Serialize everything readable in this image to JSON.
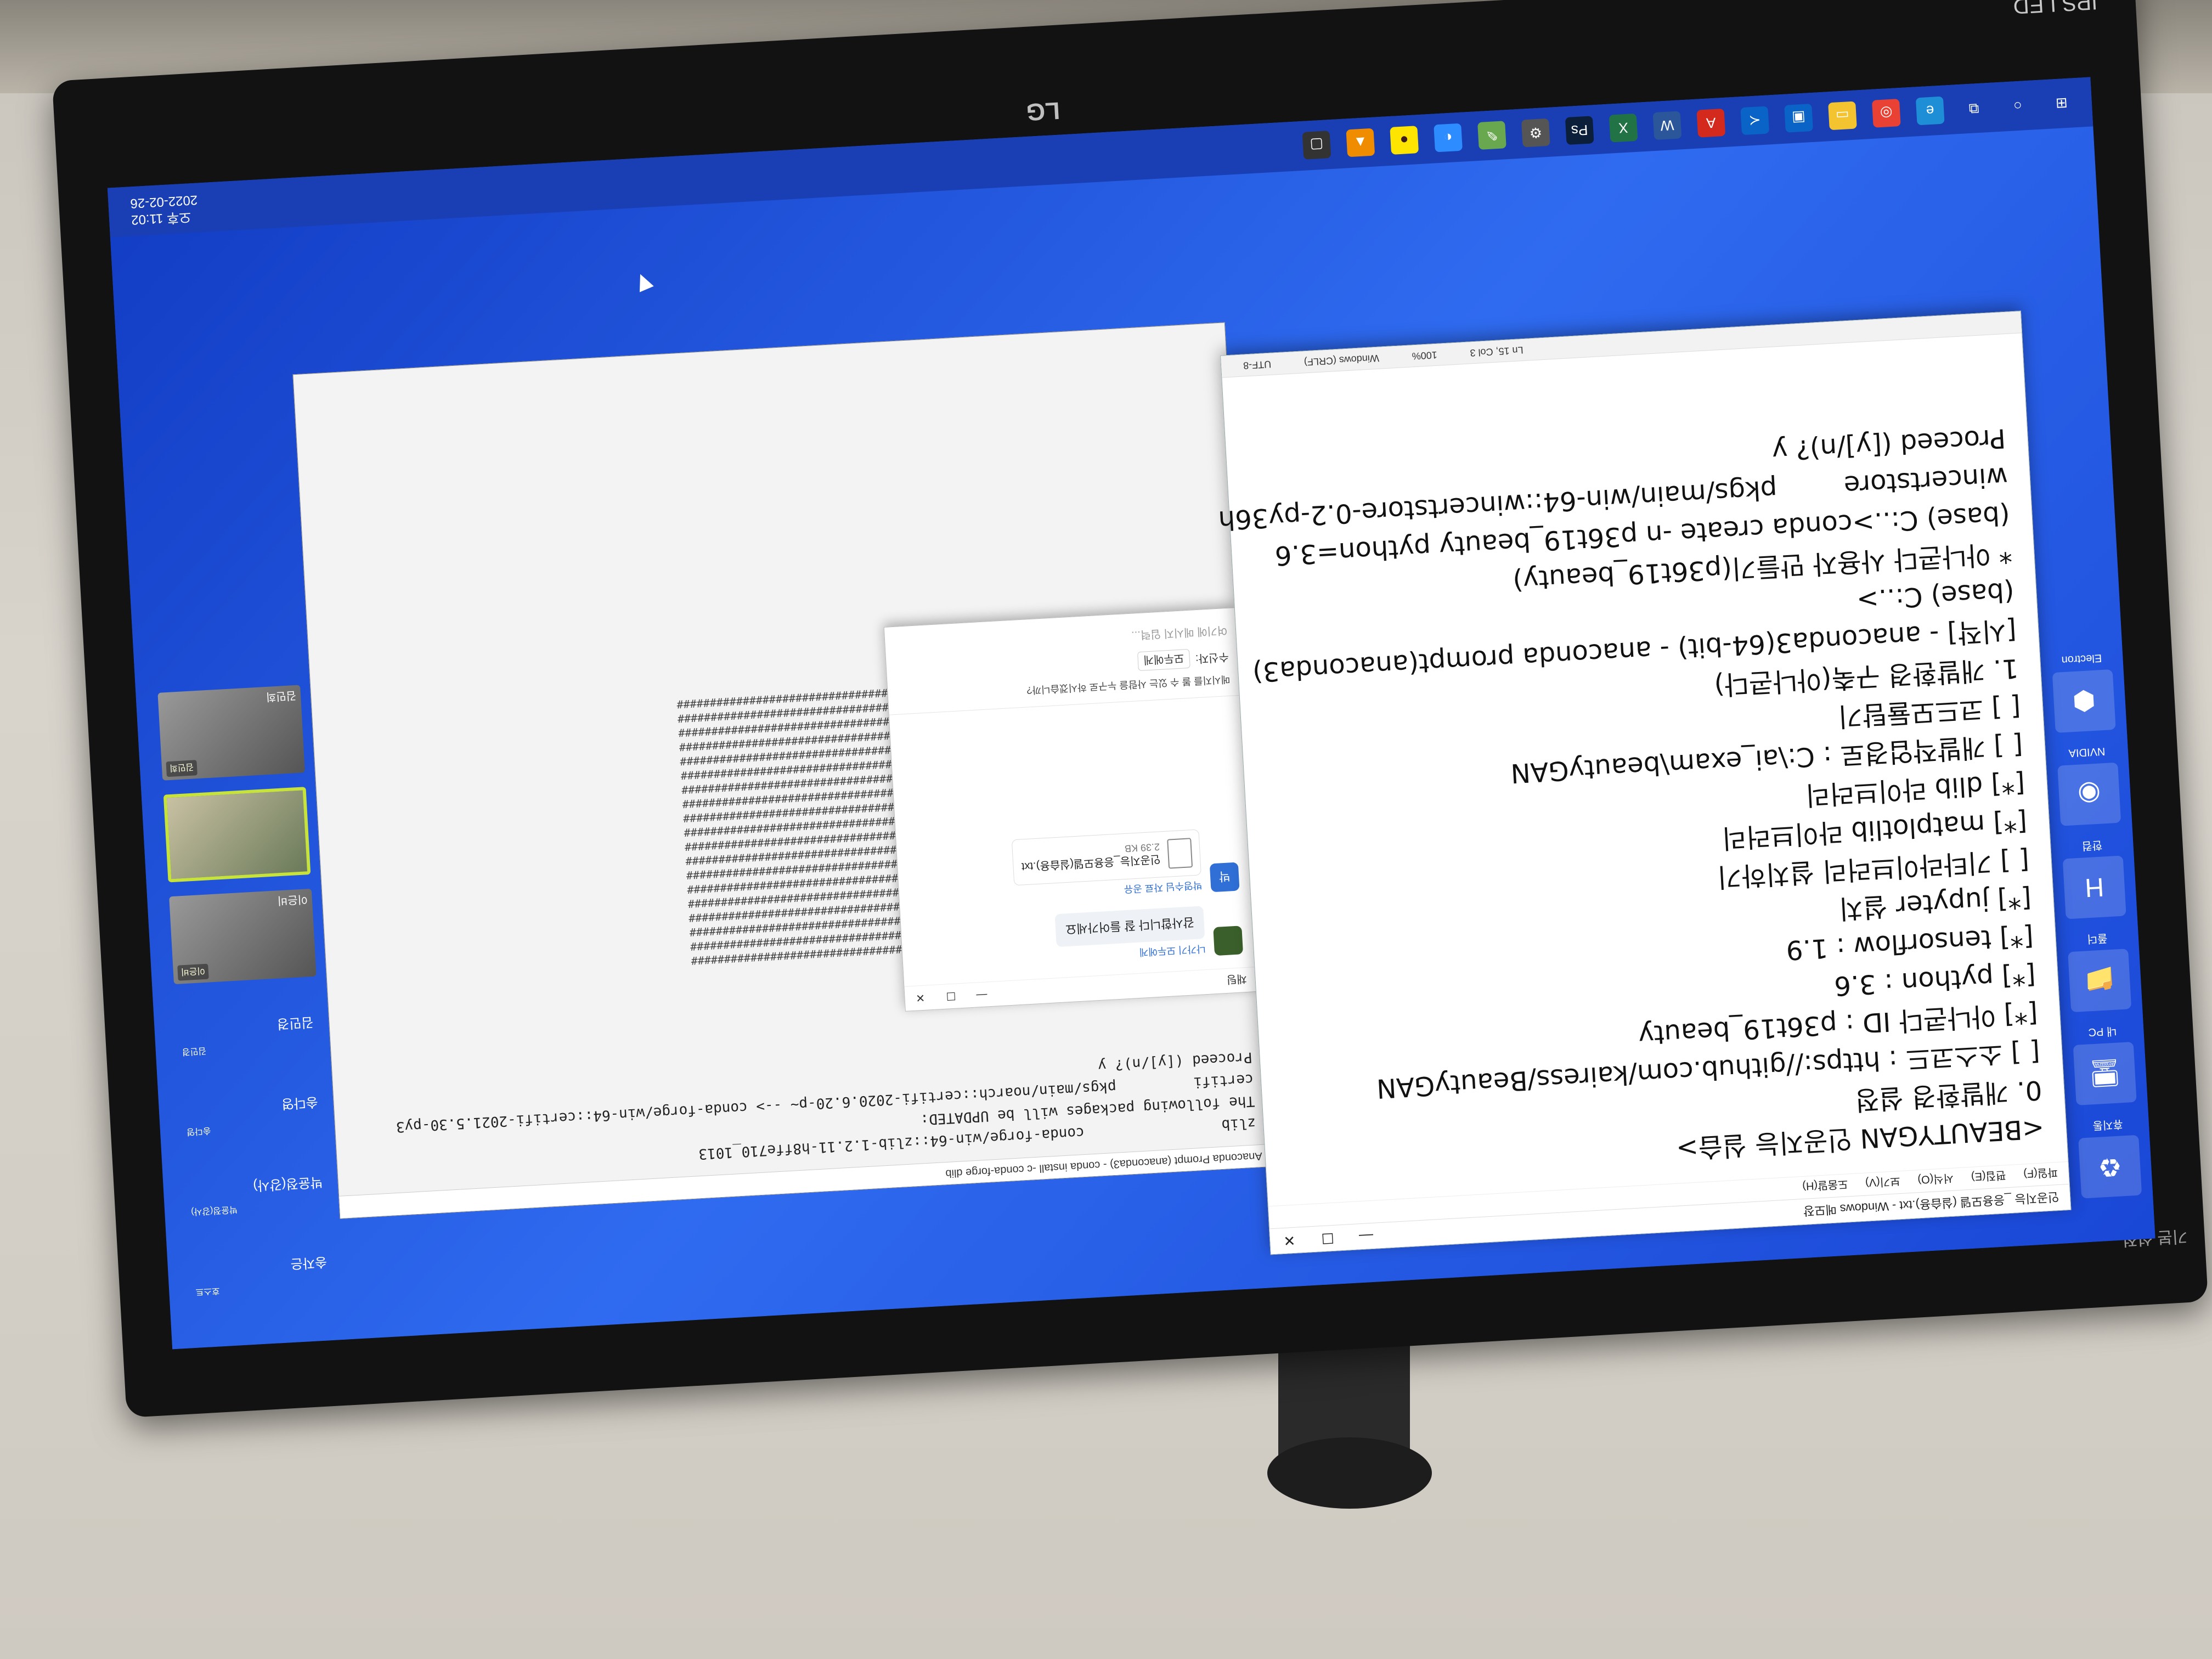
{
  "monitor": {
    "brand": "LG",
    "panel_label": "IPS LED",
    "bezel_text": "기본 설정"
  },
  "notepad": {
    "title": "인공지능 _응용모델 (실습용).txt - Windows 메모장",
    "menu": [
      "파일(F)",
      "편집(E)",
      "서식(O)",
      "보기(V)",
      "도움말(H)"
    ],
    "lines": [
      "<BEAUTYGAN 인공지능 실습>",
      "0. 개발환경 설정",
      "[ ] 소스코드 : https://github.com/kairess/BeautyGAN",
      "[*] 아나콘다 ID : p36t19_beauty",
      "[*] python : 3.6",
      "[*] tensorflow : 1.9",
      "[*] jupyter 설치",
      "[ ] 기타라이브러리 설치하기",
      "[*] matplotlib 라이브러리",
      "[*] dlib 라이브러리",
      "[ ] 개발작업경로 : C:\\ai_exam\\beautyGAN",
      "[ ] 코드모듈탐기",
      "1. 개발환경 구축(아나콘다)",
      "[시작] - anaconda3(64-bit) - anaconda prompt(anaconda3)",
      "(base) C:..>",
      "* 아나콘다 사용자 만들기(p36t19_beauty)",
      "(base) C:..>conda create -n p36t19_beauty python=3.6",
      "wincertstore        pkgs/main/win-64::wincertstore-0.2-py36h",
      "Proceed ([y]/n)? y"
    ],
    "status": {
      "position": "Ln 15, Col 3",
      "zoom": "100%",
      "eol": "Windows (CRLF)",
      "encoding": "UTF-8"
    }
  },
  "prompt": {
    "title": "Anaconda Prompt (anaconda3) - conda  install -c conda-forge dlib",
    "lines": [
      "zlib                conda-forge/win-64::zlib-1.2.11-h8ffe710_1013",
      "",
      "The following packages will be UPDATED:",
      "",
      "certifi         pkgs/main/noarch::certifi-2020.6.20-p~ --> conda-forge/win-64::certifi-2021.5.30-py3",
      "",
      "Proceed ([y]/n)? y"
    ]
  },
  "chat": {
    "title": "채팅",
    "recipient_label": "나가기 모두에게",
    "message1": "감사합니다 잘 들어가세요",
    "sender2": "박영수님 자료 공유",
    "file_name": "인공지능_응용모델(실습용).txt",
    "file_size": "2.39 KB",
    "notice": "메시지를 볼 수 있는 사람을 누구로 하시겠습니까?",
    "to_label": "수신자:",
    "to_value": "모두에게",
    "input_placeholder": "여기에 메시지 입력..."
  },
  "participants": [
    {
      "name": "송자은",
      "tag": "호스트",
      "type": "plain"
    },
    {
      "name": "박윤정(강사)",
      "tag": "박윤정(강사)",
      "type": "plain"
    },
    {
      "name": "송다영",
      "tag": "송다영",
      "type": "plain"
    },
    {
      "name": "김민경",
      "tag": "김민경",
      "type": "plain"
    },
    {
      "name": "이은비",
      "tag": "이은비",
      "type": "cam"
    },
    {
      "name": "",
      "tag": "",
      "type": "active"
    },
    {
      "name": "김민희",
      "tag": "김민희",
      "type": "cam"
    }
  ],
  "taskbar": {
    "clock_time": "오후 11:02",
    "clock_date": "2022-02-26",
    "icons": [
      "windows-start-icon",
      "search-icon",
      "task-view-icon",
      "edge-icon",
      "chrome-icon",
      "explorer-icon",
      "store-icon",
      "vscode-icon",
      "acrobat-icon",
      "word-icon",
      "excel-icon",
      "photoshop-icon",
      "settings-icon",
      "paint-icon",
      "zoom-icon",
      "kakaotalk-icon",
      "vlc-icon",
      "terminal-icon"
    ]
  },
  "desktop_icons": [
    {
      "label": "휴지통",
      "icon": "recycle-bin-icon"
    },
    {
      "label": "내 PC",
      "icon": "computer-icon"
    },
    {
      "label": "폴더",
      "icon": "folder-icon"
    },
    {
      "label": "한컴",
      "icon": "hancom-icon"
    },
    {
      "label": "NVIDIA",
      "icon": "nvidia-icon"
    },
    {
      "label": "Electron",
      "icon": "app-icon"
    }
  ]
}
